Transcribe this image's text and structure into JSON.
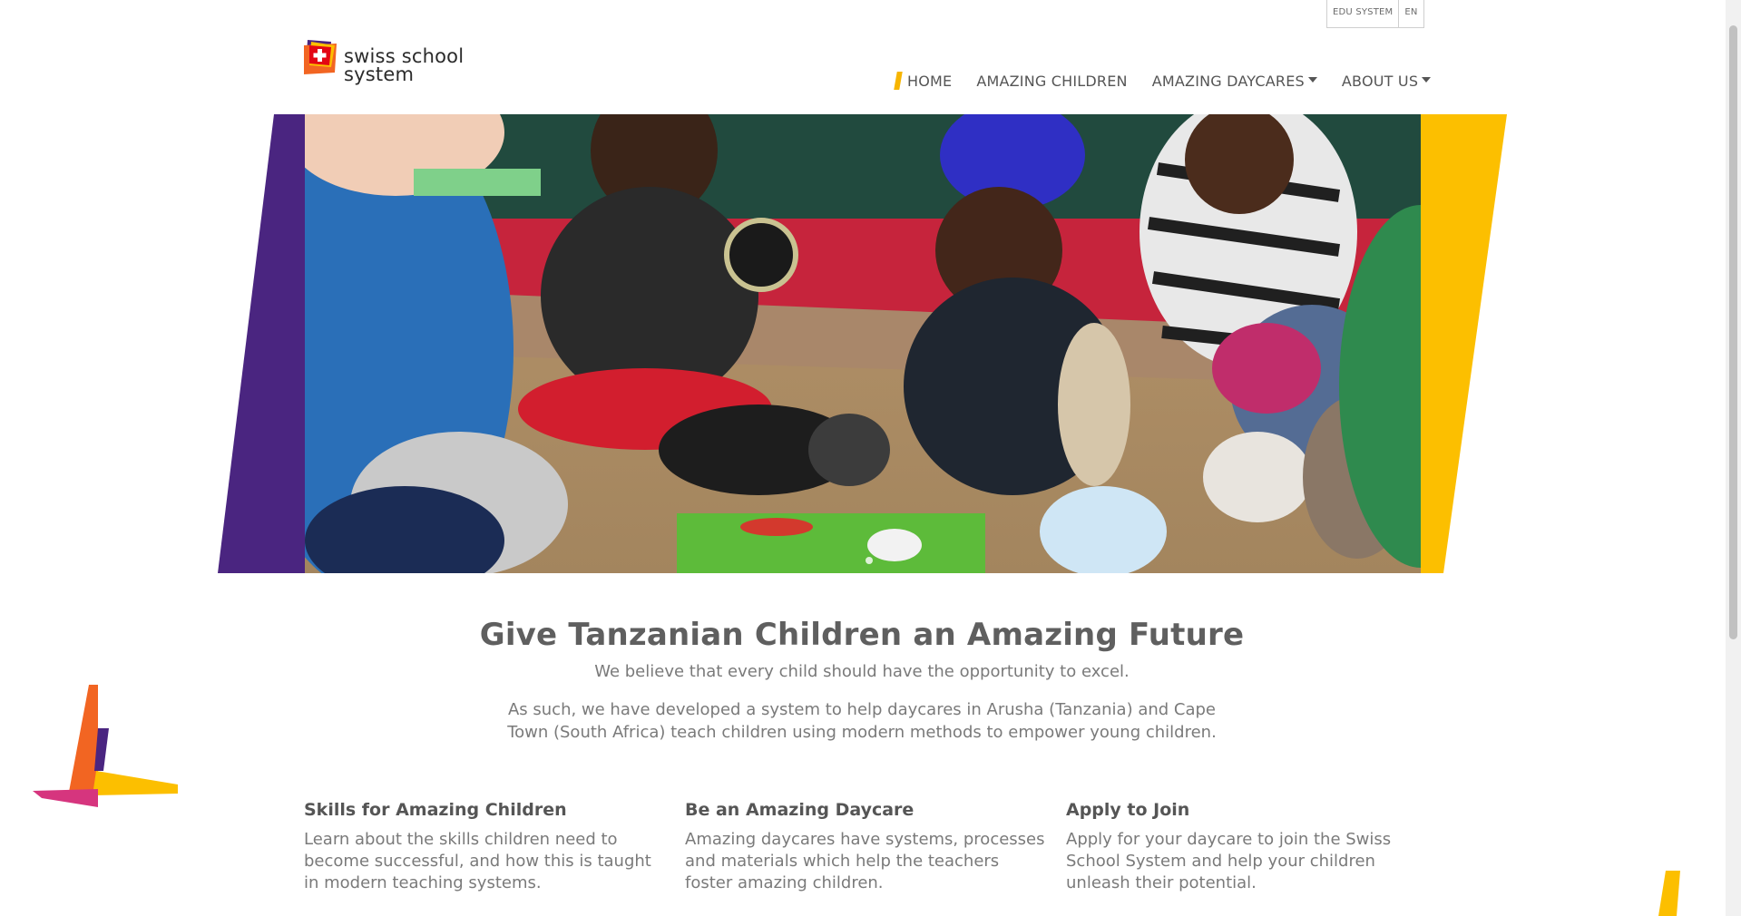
{
  "brand": {
    "name_line1": "swiss school",
    "name_line2": "system",
    "colors": {
      "purple": "#4a2580",
      "yellow": "#fcbf00",
      "orange": "#f26522",
      "pink": "#d6357e",
      "red": "#e30613"
    }
  },
  "utility": {
    "system_label": "EDU SYSTEM",
    "language_label": "EN"
  },
  "nav": {
    "items": [
      {
        "label": "HOME",
        "has_dropdown": false
      },
      {
        "label": "AMAZING CHILDREN",
        "has_dropdown": false
      },
      {
        "label": "AMAZING DAYCARES",
        "has_dropdown": true
      },
      {
        "label": "ABOUT US",
        "has_dropdown": true
      }
    ]
  },
  "hero": {
    "image_alt": "children-playing-on-mat-photo"
  },
  "intro": {
    "headline": "Give Tanzanian Children an Amazing Future",
    "line1": "We believe that every child should have the opportunity to excel.",
    "line2": "As such, we have developed a system to help daycares in Arusha (Tanzania) and Cape Town (South Africa) teach children using modern methods to empower young children."
  },
  "features": [
    {
      "title": "Skills for Amazing Children",
      "text": "Learn about the skills children need to become successful, and how this is taught in modern teaching systems."
    },
    {
      "title": "Be an Amazing Daycare",
      "text": "Amazing daycares have systems, processes and materials which help the teachers foster amazing children."
    },
    {
      "title": "Apply to Join",
      "text": "Apply for your daycare to join the Swiss School System and help your children unleash their potential."
    }
  ]
}
